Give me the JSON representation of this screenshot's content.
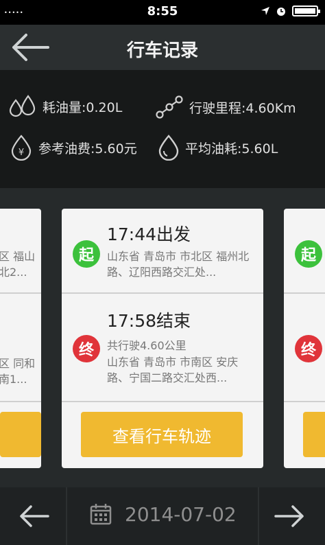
{
  "status_bar": {
    "time": "8:55",
    "signal_dots": "•••••"
  },
  "header": {
    "title": "行车记录",
    "back_icon": "arrow-left-icon"
  },
  "stats": {
    "fuel_used": "耗油量:0.20L",
    "distance": "行驶里程:4.60Km",
    "fuel_cost": "参考油费:5.60元",
    "avg_consumption": "平均油耗:5.60L"
  },
  "trip": {
    "start_badge": "起",
    "start_time": "17:44出发",
    "start_address": "山东省 青岛市 市北区 福州北路、辽阳西路交汇处...",
    "end_badge": "终",
    "end_time": "17:58结束",
    "end_distance": "共行驶4.60公里",
    "end_address": "山东省 青岛市 市南区 安庆路、宁国二路交汇处西...",
    "view_route_label": "查看行车轨迹"
  },
  "prev_card": {
    "start_peek_line1": "区 福山",
    "start_peek_line2": "北2...",
    "end_peek_line1": "区 同和",
    "end_peek_line2": "南1..."
  },
  "next_card": {
    "start_badge": "起",
    "end_badge": "终"
  },
  "footer": {
    "date": "2014-07-02"
  },
  "colors": {
    "accent": "#f0b930",
    "start_green": "#3cc13c",
    "end_red": "#e0343a"
  }
}
